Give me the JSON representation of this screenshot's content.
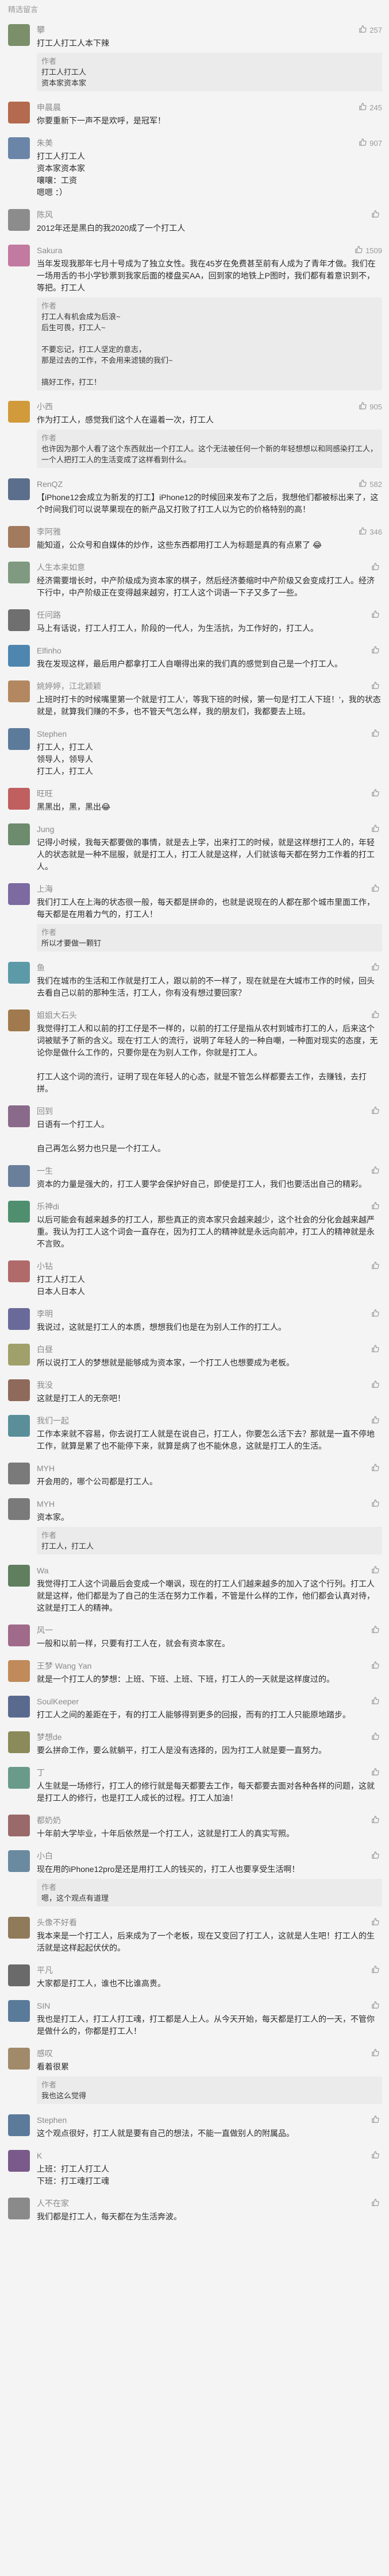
{
  "header": {
    "section_title": "精选留言"
  },
  "comments": [
    {
      "name": "攀",
      "likes": "257",
      "color": "#7a8f6a",
      "lines": [
        "打工人打工人本下辣"
      ],
      "reply": {
        "author": "作者",
        "lines": [
          "打工人打工人",
          "资本家资本家"
        ]
      }
    },
    {
      "name": "申晨晨",
      "likes": "245",
      "color": "#b36a4e",
      "lines": [
        "你要重新下一声不是欢呼，是冠军！"
      ]
    },
    {
      "name": "朱美",
      "likes": "907",
      "color": "#6a85a8",
      "lines": [
        "打工人打工人",
        "资本家资本家",
        "嚷嚷：工资",
        "嗯嗯 ：）"
      ]
    },
    {
      "name": "陈风",
      "likes": "",
      "color": "#8c8c8c",
      "lines": [
        "2012年还是黑白的我2020成了一个打工人"
      ]
    },
    {
      "name": "Sakura",
      "likes": "1509",
      "color": "#c27aa0",
      "lines": [
        "当年发现我那年七月十号成为了独立女性。我在45岁在免费甚至前有人成为了青年才做。我们在一场用舌的书小学钞票到我家后面的楼盘买AA，回到家的地铁上P图时，我们都有着意识到不，等把。打工人"
      ],
      "reply": {
        "author": "作者",
        "lines": [
          "打工人有机会成为后浪~",
          "后生可畏，打工人~",
          "",
          "不要忘记，打工人坚定的意志，",
          "那是过去的工作，不会用来滤镜的我们~",
          "",
          "搞好工作，打工！"
        ]
      }
    },
    {
      "name": "小西",
      "likes": "905",
      "color": "#d19a3a",
      "lines": [
        "作为打工人，感觉我们这个人在逼着一次，打工人"
      ],
      "reply": {
        "author": "作者",
        "lines": [
          "也许因为那个人看了这个东西就出一个打工人。这个无法被任何一个新的年轻想想以和同感染打工人，一个人把打工人的生活变成了这样看到什么。"
        ]
      }
    },
    {
      "name": "RenQZ",
      "likes": "582",
      "color": "#5b6f8c",
      "lines": [
        "【iPhone12会成立为新发的打工】iPhone12的时候回来发布了之后，我想他们都被标出来了，这个时间我们可以说苹果现在的新产品又打败了打工人以为它的价格特别的高！"
      ]
    },
    {
      "name": "李阿雅",
      "likes": "346",
      "color": "#a27a5e",
      "lines": [
        "能知道，公众号和自媒体的炒作，这些东西都用打工人为标题是真的有点累了 😂"
      ]
    },
    {
      "name": "人生本来如意",
      "likes": "",
      "color": "#7f9a80",
      "lines": [
        "经济需要增长时，中产阶级成为资本家的棋子，然后经济萎缩时中产阶级又会变成打工人。经济下行中，中产阶级正在变得越来越穷，打工人这个词语一下子又多了一些。"
      ]
    },
    {
      "name": "任问路",
      "likes": "",
      "color": "#6f6f6f",
      "lines": [
        "马上有话说，打工人打工人，阶段的一代人，为生活抗，为工作好的，打工人。"
      ]
    },
    {
      "name": "Elfinho",
      "likes": "",
      "color": "#4e86b0",
      "lines": [
        "我在发现这样，最后用户都拿打工人自嘲得出来的我们真的感觉到自己是一个打工人。"
      ]
    },
    {
      "name": "姚婷婷，江北颖颖",
      "likes": "",
      "color": "#b38860",
      "lines": [
        "上班时打卡的时候嘴里第一个就是'打工人'，等我下班的时候，第一句是'打工人下班！'，我的状态就是，就算我们赚的不多，也不管天气怎么样，我的朋友们，我都要去上班。"
      ]
    },
    {
      "name": "Stephen",
      "likes": "",
      "color": "#5c7a9a",
      "lines": [
        "打工人，打工人",
        "领导人，领导人",
        "打工人，打工人"
      ]
    },
    {
      "name": "旺旺",
      "likes": "",
      "color": "#c05f5f",
      "lines": [
        "黑黑出，黑，黑出😂"
      ]
    },
    {
      "name": "Jung",
      "likes": "",
      "color": "#6d8b6d",
      "lines": [
        "记得小时候，我每天都要做的事情，就是去上学，出来打工的时候，就是这样想打工人的，年轻人的状态就是一种不屈服，就是打工人，打工人就是这样，人们就该每天都在努力工作着的打工人。"
      ]
    },
    {
      "name": "上海",
      "likes": "",
      "color": "#7c6aa0",
      "lines": [
        "我们打工人在上海的状态很一般，每天都是拼命的，也就是说现在的人都在那个城市里面工作，每天都是在用着力气的，打工人！"
      ],
      "reply": {
        "author": "作者",
        "lines": [
          "所以才要做一颗钉"
        ]
      }
    },
    {
      "name": "鱼",
      "likes": "",
      "color": "#5d9aa8",
      "lines": [
        "我们在城市的生活和工作就是打工人，跟以前的不一样了，现在就是在大城市工作的时候，回头去看自己以前的那种生活，打工人，你有没有想过要回家？"
      ]
    },
    {
      "name": "姐姐大石头",
      "likes": "",
      "color": "#a07a4e",
      "lines": [
        "我觉得打工人和以前的打工仔是不一样的，以前的打工仔是指从农村到城市打工的人，后来这个词被赋予了新的含义。现在'打工人'的流行，说明了年轻人的一种自嘲，一种面对现实的态度，无论你是做什么工作的，只要你是在为别人工作，你就是打工人。",
        "",
        "打工人这个词的流行，证明了现在年轻人的心态，就是不管怎么样都要去工作，去赚钱，去打拼。"
      ]
    },
    {
      "name": "回到",
      "likes": "",
      "color": "#8a6a8a",
      "lines": [
        "日语有一个打工人。",
        "",
        "自己再怎么努力也只是一个打工人。"
      ]
    },
    {
      "name": "一生",
      "likes": "",
      "color": "#6a7f9a",
      "lines": [
        "资本的力量是强大的，打工人要学会保护好自己，即使是打工人，我们也要活出自己的精彩。"
      ]
    },
    {
      "name": "乐神di",
      "likes": "",
      "color": "#4f8f6f",
      "lines": [
        "以后可能会有越来越多的打工人，那些真正的资本家只会越来越少，这个社会的分化会越来越严重。我认为打工人这个词会一直存在，因为打工人的精神就是永远向前冲，打工人的精神就是永不言败。"
      ]
    },
    {
      "name": "小钻",
      "likes": "",
      "color": "#b06a6a",
      "lines": [
        "打工人打工人",
        "日本人日本人"
      ]
    },
    {
      "name": "李明",
      "likes": "",
      "color": "#6a6a9a",
      "lines": [
        "我说过，这就是打工人的本质，想想我们也是在为别人工作的打工人。"
      ]
    },
    {
      "name": "白昼",
      "likes": "",
      "color": "#a0a06a",
      "lines": [
        "所以说打工人的梦想就是能够成为资本家，一个打工人也想要成为老板。"
      ]
    },
    {
      "name": "我没",
      "likes": "",
      "color": "#8f6a5a",
      "lines": [
        "这就是打工人的无奈吧！"
      ]
    },
    {
      "name": "我们一起",
      "likes": "",
      "color": "#5a8f9a",
      "lines": [
        "工作本来就不容易，你去说打工人就是在说自己，打工人，你要怎么活下去？那就是一直不停地工作，就算是累了也不能停下来，就算是病了也不能休息，这就是打工人的生活。"
      ]
    },
    {
      "name": "MYH",
      "likes": "",
      "color": "#7a7a7a",
      "lines": [
        "开会用的，哪个公司都是打工人。"
      ]
    },
    {
      "name": "MYH",
      "likes": "",
      "color": "#7a7a7a",
      "lines": [
        "资本家。"
      ],
      "reply": {
        "author": "作者",
        "lines": [
          "打工人，打工人"
        ]
      }
    },
    {
      "name": "Wa",
      "likes": "",
      "color": "#5f7f5f",
      "lines": [
        "我觉得打工人这个词最后会变成一个嘲讽，现在的打工人们越来越多的加入了这个行列。打工人就是这样，他们都是为了自己的生活在努力工作着，不管是什么样的工作，他们都会认真对待，这就是打工人的精神。"
      ]
    },
    {
      "name": "风一",
      "likes": "",
      "color": "#a06a8a",
      "lines": [
        "一般和以前一样，只要有打工人在，就会有资本家在。"
      ]
    },
    {
      "name": "王梦 Wang Yan",
      "likes": "",
      "color": "#c08a5a",
      "lines": [
        "就是一个打工人的梦想：上班、下班、上班、下班，打工人的一天就是这样度过的。"
      ]
    },
    {
      "name": "SoulKeeper",
      "likes": "",
      "color": "#5a6a8f",
      "lines": [
        "打工人之间的差距在于，有的打工人能够得到更多的回报，而有的打工人只能原地踏步。"
      ]
    },
    {
      "name": "梦想de",
      "likes": "",
      "color": "#8a8a5a",
      "lines": [
        "要么拼命工作，要么就躺平，打工人是没有选择的，因为打工人就是要一直努力。"
      ]
    },
    {
      "name": "丁",
      "likes": "",
      "color": "#6a9a8a",
      "lines": [
        "人生就是一场修行，打工人的修行就是每天都要去工作，每天都要去面对各种各样的问题，这就是打工人的修行，也是打工人成长的过程。打工人加油！"
      ]
    },
    {
      "name": "都奶奶",
      "likes": "",
      "color": "#9a6a6a",
      "lines": [
        "十年前大学毕业，十年后依然是一个打工人，这就是打工人的真实写照。"
      ]
    },
    {
      "name": "小白",
      "likes": "",
      "color": "#6a8aa0",
      "lines": [
        "现在用的iPhone12pro是还是用打工人的钱买的，打工人也要享受生活啊！"
      ],
      "reply": {
        "author": "作者",
        "lines": [
          "嗯，这个观点有道理"
        ]
      }
    },
    {
      "name": "头像不好看",
      "likes": "",
      "color": "#8f7a5a",
      "lines": [
        "我本来是一个打工人，后来成为了一个老板，现在又变回了打工人，这就是人生吧！打工人的生活就是这样起起伏伏的。"
      ]
    },
    {
      "name": "平凡",
      "likes": "",
      "color": "#6a6a6a",
      "lines": [
        "大家都是打工人，谁也不比谁高贵。"
      ]
    },
    {
      "name": "SIN",
      "likes": "",
      "color": "#5a7a9a",
      "lines": [
        "我也是打工人，打工人打工魂，打工都是人上人。从今天开始，每天都是打工人的一天，不管你是做什么的，你都是打工人！"
      ]
    },
    {
      "name": "感叹",
      "likes": "",
      "color": "#a08a6a",
      "lines": [
        "看着很累"
      ],
      "reply": {
        "author": "作者",
        "lines": [
          "我也这么觉得"
        ]
      }
    },
    {
      "name": "Stephen",
      "likes": "",
      "color": "#5c7a9a",
      "lines": [
        "这个观点很好，打工人就是要有自己的想法，不能一直做别人的附属品。"
      ]
    },
    {
      "name": "K",
      "likes": "",
      "color": "#7a5a8a",
      "lines": [
        "上班：打工人打工人",
        "下班：打工魂打工魂"
      ]
    },
    {
      "name": "人不在家",
      "likes": "",
      "color": "#8a8a8a",
      "lines": [
        "我们都是打工人，每天都在为生活奔波。"
      ]
    }
  ]
}
